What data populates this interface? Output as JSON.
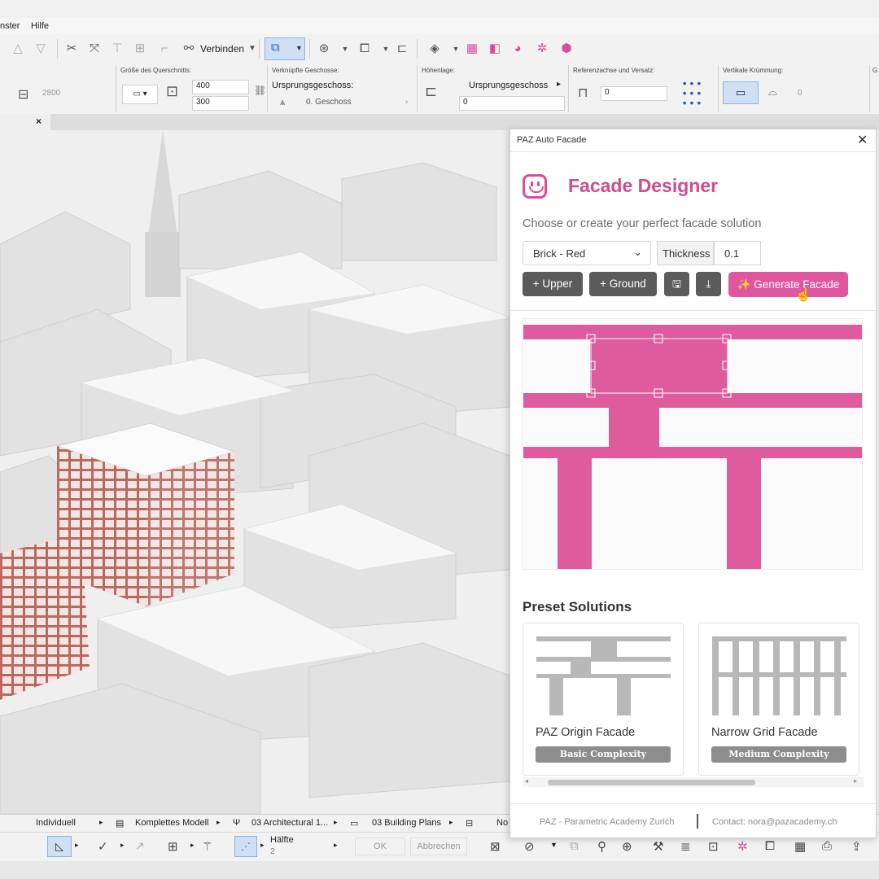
{
  "menu": {
    "items": [
      "nster",
      "Hilfe"
    ]
  },
  "toolbar": {
    "connect_label": "Verbinden"
  },
  "info_box": {
    "left_value": "2800",
    "section_label": "Größe des Querschnitts:",
    "width_value": "400",
    "height_value": "300",
    "linked_label": "Verknüpfte Geschosse:",
    "origin_label": "Ursprungsgeschoss:",
    "origin_value": "0. Geschoss",
    "height_label": "Höhenlage:",
    "height_ref_value": "Ursprungsgeschoss",
    "height_offset_value": "0",
    "ref_label": "Referenzachse und Versatz:",
    "ref_value": "0",
    "curve_label": "Vertikale Krümmung:",
    "curve_value": "0",
    "extra_label": "G"
  },
  "viewport": {
    "close_glyph": "×"
  },
  "status_bar": {
    "items": [
      "Individuell",
      "Komplettes Modell",
      "03 Architectural 1...",
      "03 Building Plans",
      "No"
    ]
  },
  "bottom_bar": {
    "half_label": "Hälfte",
    "half_value": "2",
    "ok_label": "OK",
    "cancel_label": "Abbrechen"
  },
  "panel": {
    "window_title": "PAZ Auto Facade",
    "title": "Facade Designer",
    "subtitle": "Choose or create your perfect facade solution",
    "material_value": "Brick - Red",
    "thickness_label": "Thickness",
    "thickness_value": "0.1",
    "buttons": {
      "upper": "+ Upper",
      "ground": "+ Ground",
      "generate": "✨ Generate Facade"
    },
    "preset_title": "Preset Solutions",
    "presets": [
      {
        "name": "PAZ Origin Facade",
        "badge": "Basic Complexity"
      },
      {
        "name": "Narrow Grid Facade",
        "badge": "Medium Complexity"
      }
    ],
    "footer_left": "PAZ - Parametric Academy Zurich",
    "footer_right": "Contact: nora@pazacademy.ch"
  },
  "colors": {
    "accent": "#d94c98",
    "button_dark": "#5b5b5b",
    "preset_gray": "#b8b8b8",
    "brick": "#b86a62"
  }
}
